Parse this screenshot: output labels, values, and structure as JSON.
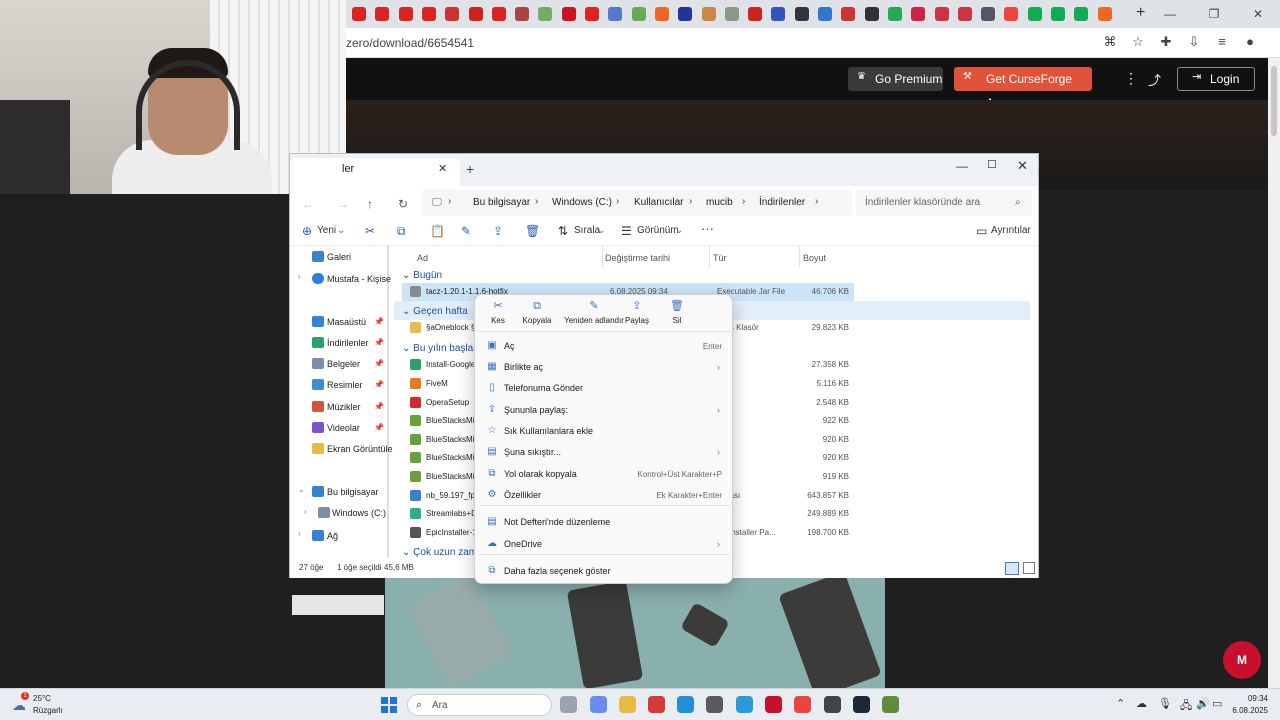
{
  "browser": {
    "url": "zero/download/6654541",
    "new_tab": "+",
    "window_controls": {
      "minimize": "—",
      "restore": "❐",
      "close": "✕"
    }
  },
  "curseforge": {
    "go_premium": "Go Premium",
    "get_app": "Get CurseForge App",
    "login": "Login"
  },
  "explorer": {
    "tab_label": "ler",
    "address": [
      "Bu bilgisayar",
      "Windows (C:)",
      "Kullanıcılar",
      "mucib",
      "İndirilenler"
    ],
    "search_placeholder": "İndirilenler klasöründe ara",
    "toolbar": {
      "new": "Yeni",
      "sort": "Sırala",
      "view": "Görünüm",
      "more": "···",
      "details": "Ayrıntılar"
    },
    "sidebar": [
      {
        "label": "Galeri",
        "color": "#3b7fd4"
      },
      {
        "label": "Mustafa - Kişise",
        "color": "#2a82d8"
      },
      {
        "label": "Masaüstü",
        "color": "#2f86d6"
      },
      {
        "label": "İndirilenler",
        "color": "#2aa06a"
      },
      {
        "label": "Belgeler",
        "color": "#7a8ea6"
      },
      {
        "label": "Resimler",
        "color": "#3b8fd8"
      },
      {
        "label": "Müzikler",
        "color": "#d0553a"
      },
      {
        "label": "Videolar",
        "color": "#7654c9"
      },
      {
        "label": "Ekran Görüntüle",
        "color": "#e7bb45"
      },
      {
        "label": "Bu bilgisayar",
        "color": "#3b7fd4"
      },
      {
        "label": "Windows (C:)",
        "color": "#7a8ea6"
      },
      {
        "label": "Ağ",
        "color": "#3b7fd4"
      }
    ],
    "columns": {
      "name": "Ad",
      "modified": "Değiştirme tarihi",
      "type": "Tür",
      "size": "Boyut"
    },
    "groups": {
      "today": "Bugün",
      "last_week": "Geçen hafta",
      "this_year": "Bu yılın başları",
      "long_ago": "Çok uzun zama"
    },
    "rows": [
      {
        "name": "tacz-1.20.1-1.1.6-hotfix",
        "date": "6.08.2025 09:34",
        "type": "Executable Jar File",
        "size": "46.706 KB",
        "color": "#8a8a8a"
      },
      {
        "name": "§aOneblock §2(",
        "date": "",
        "type": "ılmış Klasör",
        "size": "29.823 KB",
        "color": "#e7bb45"
      },
      {
        "name": "Install-GoogleP",
        "date": "",
        "type": "ama",
        "size": "27.358 KB",
        "color": "#2aa06a"
      },
      {
        "name": "FiveM",
        "date": "",
        "type": "ama",
        "size": "5.116 KB",
        "color": "#e67a1d"
      },
      {
        "name": "OperaSetup",
        "date": "",
        "type": "ama",
        "size": "2.548 KB",
        "color": "#d42a2a"
      },
      {
        "name": "BlueStacksMicr",
        "date": "",
        "type": "ama",
        "size": "922 KB",
        "color": "#6aa03a"
      },
      {
        "name": "BlueStacksMicr",
        "date": "",
        "type": "ama",
        "size": "920 KB",
        "color": "#6aa03a"
      },
      {
        "name": "BlueStacksMicr",
        "date": "",
        "type": "ama",
        "size": "920 KB",
        "color": "#6aa03a"
      },
      {
        "name": "BlueStacksMicr",
        "date": "",
        "type": "ama",
        "size": "919 KB",
        "color": "#6aa03a"
      },
      {
        "name": "nb_59.197_fp",
        "date": "",
        "type": "osyası",
        "size": "643.857 KB",
        "color": "#3b7fd4"
      },
      {
        "name": "Streamlabs+De",
        "date": "",
        "type": "ama",
        "size": "249.889 KB",
        "color": "#2ab08a"
      },
      {
        "name": "EpicInstaller-17",
        "date": "",
        "type": "ws Installer Pa...",
        "size": "198.700 KB",
        "color": "#555555"
      }
    ],
    "status": {
      "count": "27 öğe",
      "selected": "1 öğe seçildi",
      "size": "45,6 MB"
    }
  },
  "context_menu": {
    "quick_actions": [
      {
        "label": "Kes",
        "icon": "cut-icon"
      },
      {
        "label": "Kopyala",
        "icon": "copy-icon"
      },
      {
        "label": "Yeniden adlandır",
        "icon": "rename-icon"
      },
      {
        "label": "Paylaş",
        "icon": "share-icon"
      },
      {
        "label": "Sil",
        "icon": "delete-icon"
      }
    ],
    "items": [
      {
        "label": "Aç",
        "shortcut": "Enter",
        "arrow": ""
      },
      {
        "label": "Birlikte aç",
        "shortcut": "",
        "arrow": "›"
      },
      {
        "label": "Telefonuma Gönder",
        "shortcut": "",
        "arrow": ""
      },
      {
        "label": "Şununla paylaş:",
        "shortcut": "",
        "arrow": "›"
      },
      {
        "label": "Sık Kullanılanlara ekle",
        "shortcut": "",
        "arrow": ""
      },
      {
        "label": "Şuna sıkıştır...",
        "shortcut": "",
        "arrow": "›"
      },
      {
        "label": "Yol olarak kopyala",
        "shortcut": "Kontrol+Üst Karakter+P",
        "arrow": ""
      },
      {
        "label": "Özellikler",
        "shortcut": "Ek Karakter+Enter",
        "arrow": ""
      },
      {
        "label": "Not Defteri'nde düzenleme",
        "shortcut": "",
        "arrow": ""
      },
      {
        "label": "OneDrive",
        "shortcut": "",
        "arrow": "›"
      },
      {
        "label": "Daha fazla seçenek göster",
        "shortcut": "",
        "arrow": ""
      }
    ]
  },
  "taskbar": {
    "weather_temp": "25°C",
    "weather_desc": "Rüzgarlı",
    "weather_badge": "1",
    "search_label": "Ara",
    "time": "09:34",
    "date": "6.08.2025"
  }
}
